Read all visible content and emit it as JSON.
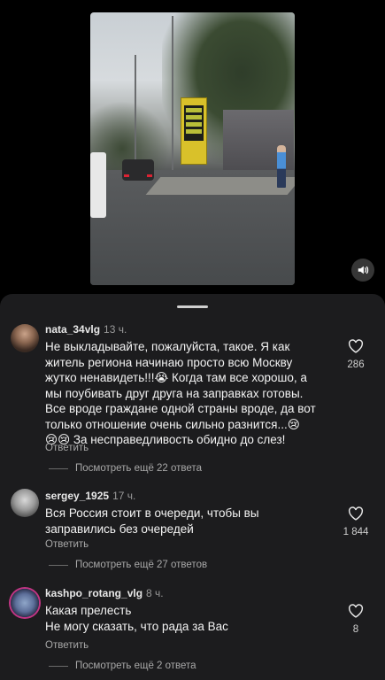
{
  "video": {
    "sound_icon": "speaker-icon"
  },
  "comments": [
    {
      "username": "nata_34vlg",
      "time": "13 ч.",
      "text": "Не выкладывайте, пожалуйста, такое. Я как\nжитель региона начинаю просто всю Москву\nжутко ненавидеть!!!😭 Когда там все хорошо, а\nмы поубивать друг друга на заправках готовы.\nВсе вроде граждане одной страны вроде, да вот\nтолько отношение  очень сильно разнится...😢\n😢😢 За несправедливость обидно до слез!",
      "reply_label": "Ответить",
      "more_replies": "Посмотреть ещё 22 ответа",
      "likes": "286"
    },
    {
      "username": "sergey_1925",
      "time": "17 ч.",
      "text": "Вся Россия стоит в очереди, чтобы вы\nзаправились без очередей",
      "reply_label": "Ответить",
      "more_replies": "Посмотреть ещё 27 ответов",
      "likes": "1 844"
    },
    {
      "username": "kashpo_rotang_vlg",
      "time": "8 ч.",
      "text": "Какая прелесть\nНе могу сказать, что рада за Вас",
      "reply_label": "Ответить",
      "more_replies": "Посмотреть ещё 2 ответа",
      "likes": "8"
    }
  ],
  "colors": {
    "sheet_background": "#1c1c1e",
    "secondary_text": "#a8a8a8",
    "primary_text": "#f3f3f3"
  }
}
